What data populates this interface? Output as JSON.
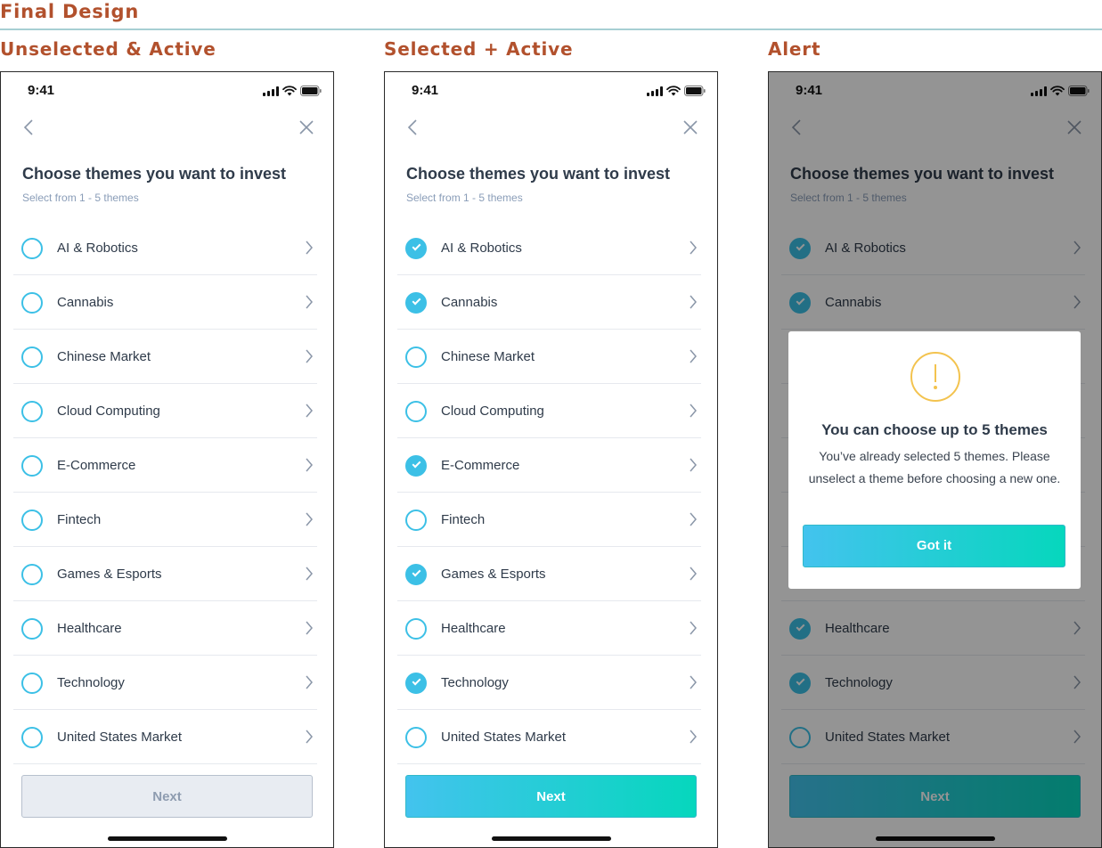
{
  "page_title": "Final Design",
  "colors": {
    "accent": "#3cc0e6",
    "gradient_start": "#43c3ee",
    "gradient_end": "#06d7bd",
    "heading": "#b2512d",
    "warning": "#f3c34f"
  },
  "status": {
    "time": "9:41"
  },
  "question": {
    "title": "Choose themes you want to invest",
    "subtitle": "Select from 1 - 5 themes"
  },
  "themes": [
    "AI & Robotics",
    "Cannabis",
    "Chinese Market",
    "Cloud Computing",
    "E-Commerce",
    "Fintech",
    "Games & Esports",
    "Healthcare",
    "Technology",
    "United States Market"
  ],
  "icons": {
    "back": "chevron-left-icon",
    "close": "close-icon",
    "row": "chevron-right-icon",
    "check": "check-icon",
    "alert": "exclamation-icon"
  },
  "screens": [
    {
      "heading": "Unselected & Active",
      "selected": [
        false,
        false,
        false,
        false,
        false,
        false,
        false,
        false,
        false,
        false
      ],
      "next_label": "Next",
      "next_state": "disabled"
    },
    {
      "heading": "Selected + Active",
      "selected": [
        true,
        true,
        false,
        false,
        true,
        false,
        true,
        false,
        true,
        false
      ],
      "next_label": "Next",
      "next_state": "active"
    },
    {
      "heading": "Alert",
      "selected": [
        true,
        true,
        false,
        false,
        true,
        false,
        true,
        true,
        true,
        false
      ],
      "next_label": "Next",
      "next_state": "active"
    }
  ],
  "alert": {
    "title": "You can choose up to 5 themes",
    "message": "You’ve already selected 5 themes. Please unselect a theme before choosing a new one.",
    "button_label": "Got it"
  }
}
